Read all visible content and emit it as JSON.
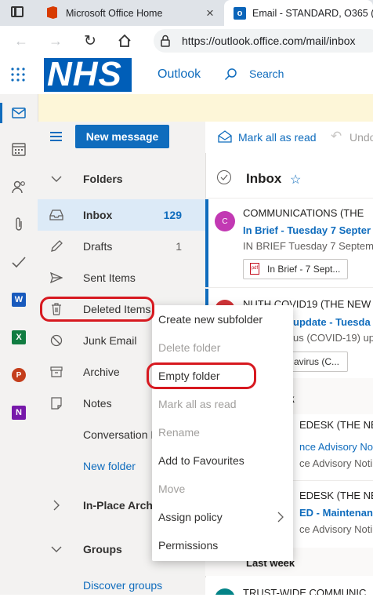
{
  "browser": {
    "tabs": [
      {
        "label": "Microsoft Office Home",
        "close": "×"
      },
      {
        "label": "Email - STANDARD, O365 (TH"
      }
    ],
    "url": "https://outlook.office.com/mail/inbox"
  },
  "header": {
    "logo_text": "NHS",
    "app_name": "Outlook",
    "search_label": "Search"
  },
  "toolbar": {
    "new_message": "New message",
    "mark_all_read": "Mark all as read",
    "undo": "Undo"
  },
  "folders": {
    "section_label": "Folders",
    "items": [
      {
        "label": "Inbox",
        "count": "129"
      },
      {
        "label": "Drafts",
        "count": "1"
      },
      {
        "label": "Sent Items",
        "count": ""
      },
      {
        "label": "Deleted Items",
        "count": ""
      },
      {
        "label": "Junk Email",
        "count": ""
      },
      {
        "label": "Archive",
        "count": ""
      },
      {
        "label": "Notes",
        "count": ""
      },
      {
        "label": "Conversation H",
        "count": ""
      }
    ],
    "new_folder": "New folder",
    "in_place_archive": "In-Place Archi",
    "groups_label": "Groups",
    "discover_groups": "Discover groups"
  },
  "inbox": {
    "title": "Inbox",
    "messages": [
      {
        "avatar": "C",
        "sender": "COMMUNICATIONS (THE",
        "subject": "In Brief - Tuesday 7 Septer",
        "preview": "IN BRIEF Tuesday 7 Septem",
        "attachment": "In Brief - 7 Sept..."
      },
      {
        "sender": "NUTH COVID19 (THE NEW",
        "subject": "update - Tuesda",
        "preview": "us (COVID-19) up",
        "attachment": "avirus (C..."
      },
      {
        "sender": "EDESK (THE NEW",
        "subject": "nce Advisory Not",
        "preview": "ce Advisory Noti"
      },
      {
        "sender": "EDESK (THE NEW",
        "subject": "ED - Maintenanc",
        "preview": "ce Advisory Noti"
      },
      {
        "sender": "TRUST-WIDE COMMUNIC"
      }
    ],
    "k_fragment": "k",
    "last_week": "Last week"
  },
  "context_menu": {
    "items": [
      {
        "label": "Create new subfolder",
        "enabled": true
      },
      {
        "label": "Delete folder",
        "enabled": false
      },
      {
        "label": "Empty folder",
        "enabled": true
      },
      {
        "label": "Mark all as read",
        "enabled": false
      },
      {
        "label": "Rename",
        "enabled": false
      },
      {
        "label": "Add to Favourites",
        "enabled": true
      },
      {
        "label": "Move",
        "enabled": false
      },
      {
        "label": "Assign policy",
        "enabled": true
      },
      {
        "label": "Permissions",
        "enabled": true
      }
    ]
  },
  "colors": {
    "nhs_blue": "#005eb8",
    "accent": "#0f6cbd",
    "highlight_ring": "#d71920"
  }
}
